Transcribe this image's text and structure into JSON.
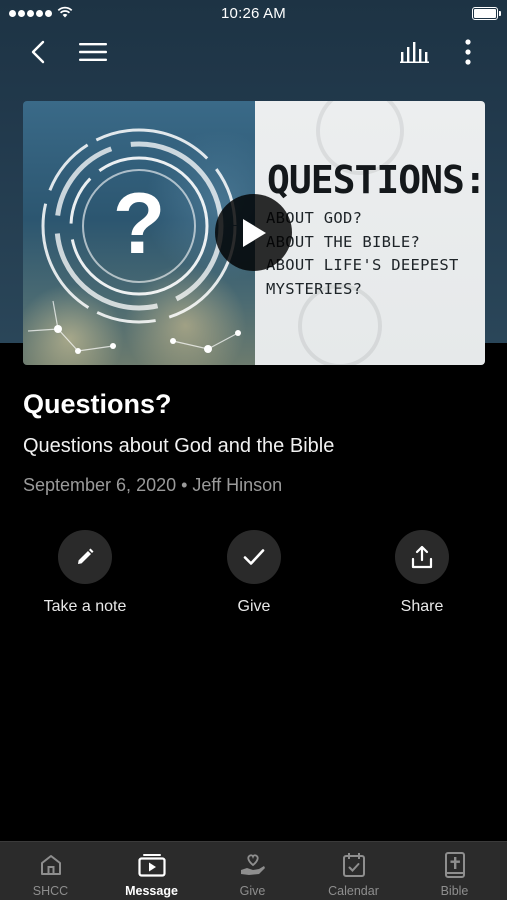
{
  "status_bar": {
    "time": "10:26 AM"
  },
  "nav": {
    "back_icon": "chevron-left-icon",
    "menu_icon": "hamburger-menu-icon",
    "audio_icon": "audio-bars-icon",
    "more_icon": "vertical-ellipsis-icon"
  },
  "thumbnail": {
    "heading": "QUESTIONS:",
    "lines": [
      "ABOUT GOD?",
      "ABOUT THE BIBLE?",
      "ABOUT LIFE'S DEEPEST",
      "MYSTERIES?"
    ],
    "play_icon": "play-icon"
  },
  "message": {
    "title": "Questions?",
    "subtitle": "Questions about God and the Bible",
    "meta": "September 6, 2020 • Jeff Hinson"
  },
  "actions": [
    {
      "label": "Take a note",
      "icon": "pencil-icon"
    },
    {
      "label": "Give",
      "icon": "checkmark-icon"
    },
    {
      "label": "Share",
      "icon": "share-icon"
    }
  ],
  "tabs": [
    {
      "label": "SHCC",
      "icon": "home-icon",
      "active": false
    },
    {
      "label": "Message",
      "icon": "video-player-icon",
      "active": true
    },
    {
      "label": "Give",
      "icon": "heart-hand-icon",
      "active": false
    },
    {
      "label": "Calendar",
      "icon": "calendar-icon",
      "active": false
    },
    {
      "label": "Bible",
      "icon": "bible-icon",
      "active": false
    }
  ],
  "colors": {
    "background": "#000000",
    "header": "#223a4d",
    "tabbar": "#2b2b2b",
    "action_circle": "#2a2a2a"
  }
}
